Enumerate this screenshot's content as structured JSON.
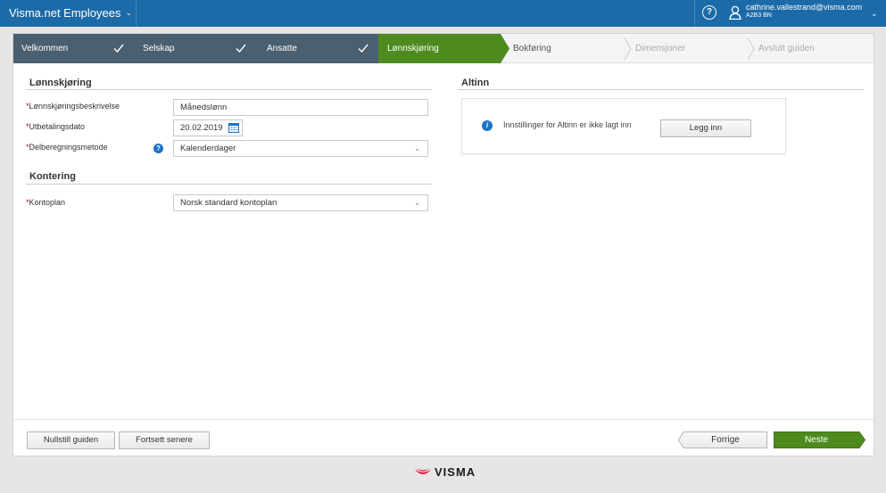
{
  "topbar": {
    "app_title": "Visma.net Employees",
    "help_label": "?",
    "user_email": "cathrine.vallestrand@visma.com",
    "user_company": "A2B3 BN"
  },
  "steps": [
    {
      "label": "Velkommen",
      "state": "done"
    },
    {
      "label": "Selskap",
      "state": "done"
    },
    {
      "label": "Ansatte",
      "state": "done"
    },
    {
      "label": "Lønnskjøring",
      "state": "active"
    },
    {
      "label": "Bokføring",
      "state": "todo"
    },
    {
      "label": "Dimensjoner",
      "state": "todo"
    },
    {
      "label": "Avslutt guiden",
      "state": "todo"
    }
  ],
  "lonn": {
    "title": "Lønnskjøring",
    "desc_label": "Lønnskjøringsbeskrivelse",
    "desc_value": "Månedslønn",
    "date_label": "Utbetalingsdato",
    "date_value": "20.02.2019",
    "method_label": "Delberegningsmetode",
    "method_value": "Kalenderdager"
  },
  "kontering": {
    "title": "Kontering",
    "plan_label": "Kontoplan",
    "plan_value": "Norsk standard kontoplan"
  },
  "altinn": {
    "title": "Altinn",
    "message": "Innstillinger for Altinn er ikke lagt inn",
    "button": "Legg inn"
  },
  "footer": {
    "reset": "Nullstill guiden",
    "later": "Fortsett senere",
    "prev": "Forrige",
    "next": "Neste"
  },
  "logo": {
    "text": "VISMA"
  },
  "colors": {
    "topbar": "#1c6ba8",
    "step_done": "#4a5f6f",
    "step_active": "#4d8b1e",
    "next_button": "#4d8b1e",
    "required": "#d0021b",
    "logo_red": "#e3173e"
  },
  "icons": {
    "help": "question-circle-icon",
    "user": "user-icon",
    "check": "checkmark-icon",
    "calendar": "calendar-icon",
    "info": "info-icon"
  }
}
